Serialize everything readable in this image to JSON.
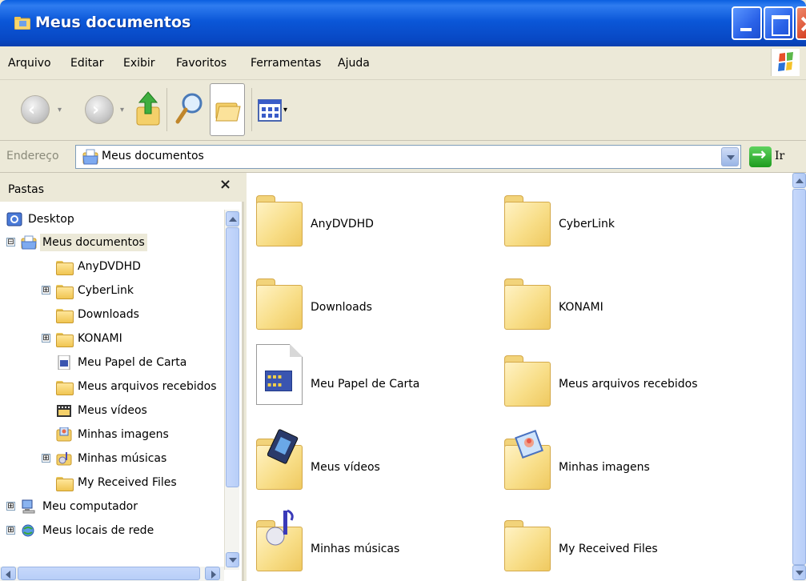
{
  "window": {
    "title": "Meus documentos",
    "title_color": "#0b57d8"
  },
  "menu": {
    "items": [
      "Arquivo",
      "Editar",
      "Exibir",
      "Favoritos",
      "Ferramentas",
      "Ajuda"
    ]
  },
  "toolbar": {
    "buttons": [
      "back-icon",
      "forward-icon",
      "up-folder-icon",
      "search-icon",
      "folders-icon",
      "views-icon"
    ]
  },
  "address": {
    "label": "Endereço",
    "value": "Meus documentos",
    "go_label": "Ir"
  },
  "folders_pane": {
    "title": "Pastas",
    "close_label": "×",
    "tree": [
      {
        "label": "Desktop",
        "icon": "desktop-icon"
      },
      {
        "label": "Meus documentos",
        "icon": "my-documents-icon",
        "expanded": true,
        "selected": true
      },
      {
        "label": "AnyDVDHD",
        "icon": "folder-icon"
      },
      {
        "label": "CyberLink",
        "icon": "folder-icon",
        "expandable": true
      },
      {
        "label": "Downloads",
        "icon": "folder-icon"
      },
      {
        "label": "KONAMI",
        "icon": "folder-icon",
        "expandable": true
      },
      {
        "label": "Meu Papel de Carta",
        "icon": "stationery-icon"
      },
      {
        "label": "Meus arquivos recebidos",
        "icon": "folder-icon"
      },
      {
        "label": "Meus vídeos",
        "icon": "videos-icon"
      },
      {
        "label": "Minhas imagens",
        "icon": "pictures-icon"
      },
      {
        "label": "Minhas músicas",
        "icon": "music-icon",
        "expandable": true
      },
      {
        "label": "My Received Files",
        "icon": "folder-icon"
      },
      {
        "label": "Meu computador",
        "icon": "computer-icon",
        "expandable": true
      },
      {
        "label": "Meus locais de rede",
        "icon": "network-icon",
        "expandable": true
      }
    ],
    "tree_expanders": [
      "⊟",
      "⊞",
      "⊞",
      "⊞",
      "⊞",
      "⊞"
    ]
  },
  "content": {
    "items": [
      {
        "label": "AnyDVDHD",
        "icon": "folder-icon"
      },
      {
        "label": "CyberLink",
        "icon": "folder-icon"
      },
      {
        "label": "Downloads",
        "icon": "folder-icon"
      },
      {
        "label": "KONAMI",
        "icon": "folder-icon"
      },
      {
        "label": "Meu Papel de Carta",
        "icon": "stationery-icon"
      },
      {
        "label": "Meus arquivos recebidos",
        "icon": "folder-icon"
      },
      {
        "label": "Meus vídeos",
        "icon": "videos-folder-icon"
      },
      {
        "label": "Minhas imagens",
        "icon": "pictures-folder-icon"
      },
      {
        "label": "Minhas músicas",
        "icon": "music-folder-icon"
      },
      {
        "label": "My Received Files",
        "icon": "folder-icon"
      }
    ]
  },
  "colors": {
    "chrome": "#ece9d8",
    "titlebar": "#0b57d8",
    "close_button": "#d8482a",
    "scrollbar": "#c6d8fb",
    "folder": "#f8de88"
  }
}
